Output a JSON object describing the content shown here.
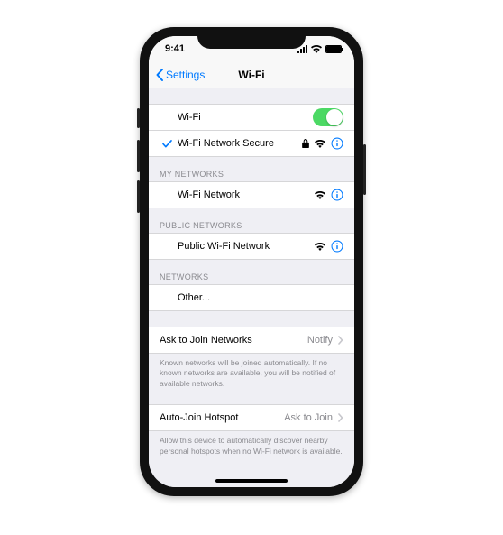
{
  "statusbar": {
    "time": "9:41"
  },
  "nav": {
    "back_label": "Settings",
    "title": "Wi-Fi"
  },
  "wifi": {
    "toggle_label": "Wi-Fi",
    "toggle_on": true,
    "connected_name": "Wi-Fi Network Secure"
  },
  "my_networks": {
    "header": "My Networks",
    "items": [
      "Wi-Fi Network"
    ]
  },
  "public_networks": {
    "header": "Public Networks",
    "items": [
      "Public Wi-Fi Network"
    ]
  },
  "other": {
    "header": "Networks",
    "other_label": "Other..."
  },
  "join": {
    "label": "Ask to Join Networks",
    "value": "Notify",
    "footer": "Known networks will be joined automatically. If no known networks are available, you will be notified of available networks."
  },
  "hotspot": {
    "label": "Auto-Join Hotspot",
    "value": "Ask to Join",
    "footer": "Allow this device to automatically discover nearby personal hotspots when no Wi-Fi network is available."
  }
}
